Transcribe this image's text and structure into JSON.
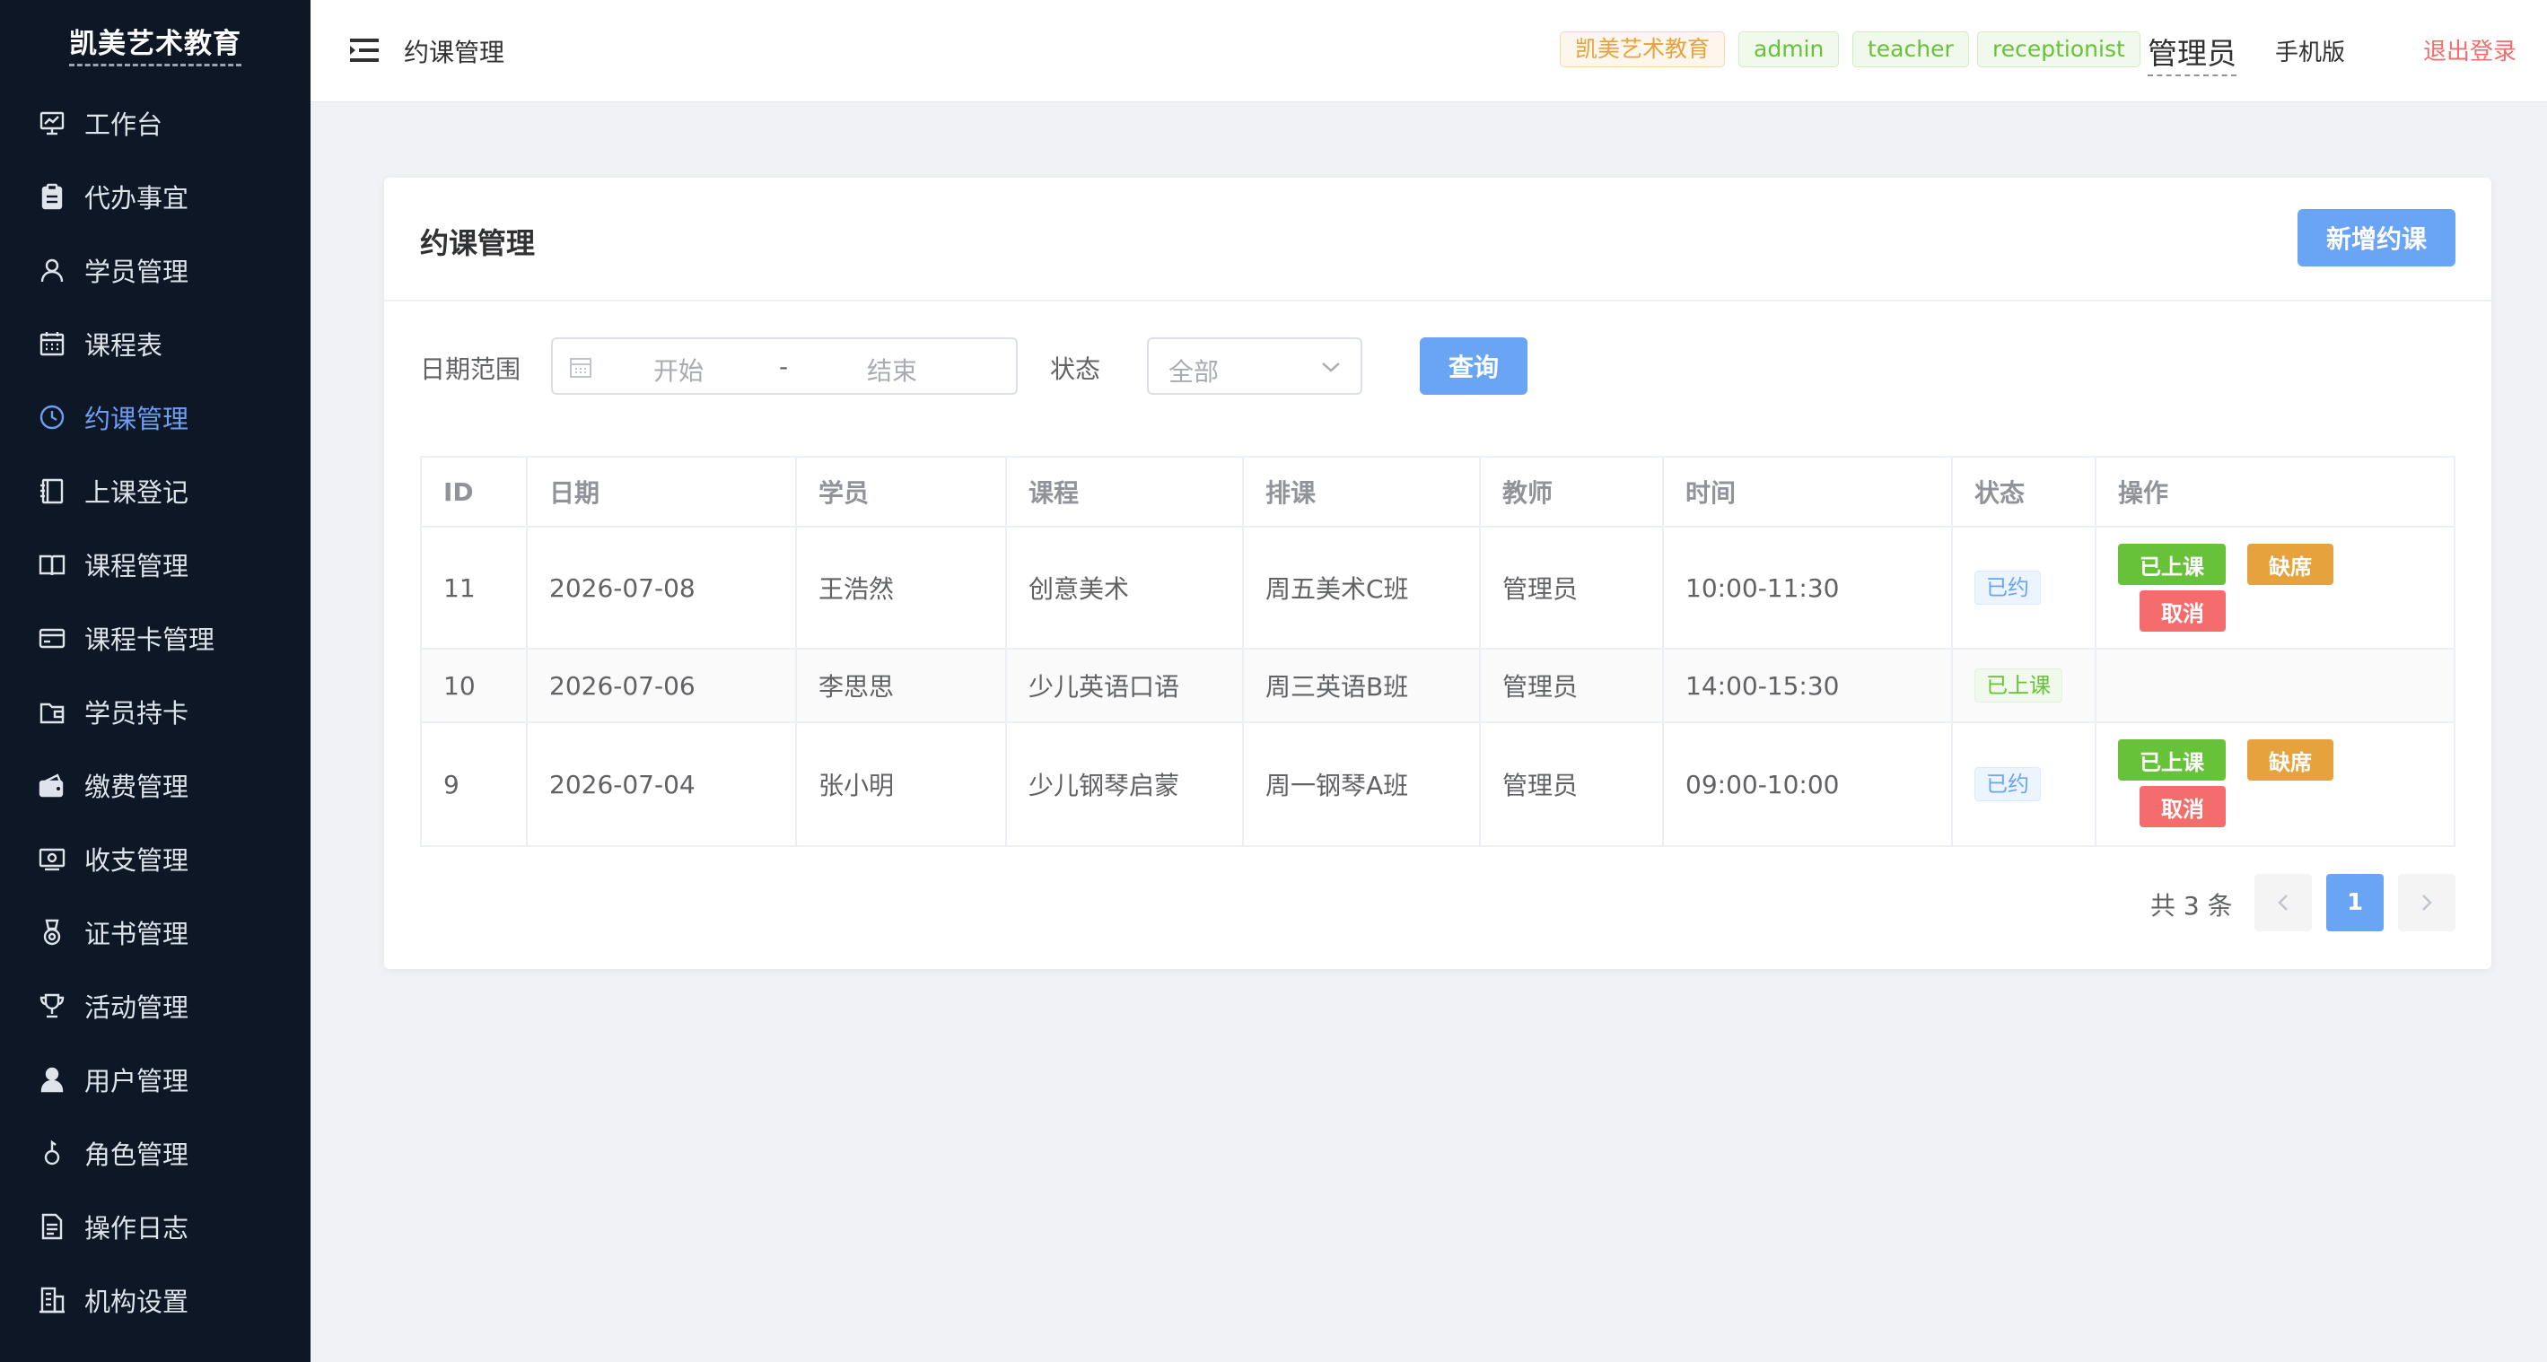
{
  "app": {
    "brand": "凯美艺术教育"
  },
  "sidebar": {
    "items": [
      {
        "label": "工作台",
        "icon": "dashboard-icon",
        "active": false
      },
      {
        "label": "代办事宜",
        "icon": "clipboard-icon",
        "active": false
      },
      {
        "label": "学员管理",
        "icon": "user-icon",
        "active": false
      },
      {
        "label": "课程表",
        "icon": "calendar-icon",
        "active": false
      },
      {
        "label": "约课管理",
        "icon": "clock-icon",
        "active": true
      },
      {
        "label": "上课登记",
        "icon": "notebook-icon",
        "active": false
      },
      {
        "label": "课程管理",
        "icon": "book-icon",
        "active": false
      },
      {
        "label": "课程卡管理",
        "icon": "credit-card-icon",
        "active": false
      },
      {
        "label": "学员持卡",
        "icon": "wallet-icon",
        "active": false
      },
      {
        "label": "缴费管理",
        "icon": "payment-icon",
        "active": false
      },
      {
        "label": "收支管理",
        "icon": "money-icon",
        "active": false
      },
      {
        "label": "证书管理",
        "icon": "medal-icon",
        "active": false
      },
      {
        "label": "活动管理",
        "icon": "trophy-icon",
        "active": false
      },
      {
        "label": "用户管理",
        "icon": "user-filled-icon",
        "active": false
      },
      {
        "label": "角色管理",
        "icon": "key-icon",
        "active": false
      },
      {
        "label": "操作日志",
        "icon": "document-icon",
        "active": false
      },
      {
        "label": "机构设置",
        "icon": "office-building-icon",
        "active": false
      }
    ]
  },
  "header": {
    "breadcrumb": "约课管理",
    "tags": [
      "凯美艺术教育",
      "admin",
      "teacher",
      "receptionist"
    ],
    "role": "管理员",
    "mobile_label": "手机版",
    "logout_label": "退出登录"
  },
  "page": {
    "title": "约课管理",
    "add_button": "新增约课",
    "filters": {
      "date_label": "日期范围",
      "start_placeholder": "开始",
      "separator": "-",
      "end_placeholder": "结束",
      "status_label": "状态",
      "status_value": "全部",
      "query_button": "查询"
    },
    "table": {
      "columns": [
        "ID",
        "日期",
        "学员",
        "课程",
        "排课",
        "教师",
        "时间",
        "状态",
        "操作"
      ],
      "rows": [
        {
          "id": "11",
          "date": "2026-07-08",
          "student": "王浩然",
          "course": "创意美术",
          "schedule": "周五美术C班",
          "teacher": "管理员",
          "time": "10:00-11:30",
          "status": "已约",
          "actions": [
            "已上课",
            "缺席",
            "取消"
          ]
        },
        {
          "id": "10",
          "date": "2026-07-06",
          "student": "李思思",
          "course": "少儿英语口语",
          "schedule": "周三英语B班",
          "teacher": "管理员",
          "time": "14:00-15:30",
          "status": "已上课",
          "actions": []
        },
        {
          "id": "9",
          "date": "2026-07-04",
          "student": "张小明",
          "course": "少儿钢琴启蒙",
          "schedule": "周一钢琴A班",
          "teacher": "管理员",
          "time": "09:00-10:00",
          "status": "已约",
          "actions": [
            "已上课",
            "缺席",
            "取消"
          ]
        }
      ]
    },
    "pagination": {
      "total_text": "共 3 条",
      "current_page": "1"
    }
  },
  "colors": {
    "sidebar_bg": "#0d1726",
    "accent": "#6aa4f5",
    "success": "#67c23a",
    "warning": "#e6a23c",
    "danger": "#f56c6c"
  }
}
